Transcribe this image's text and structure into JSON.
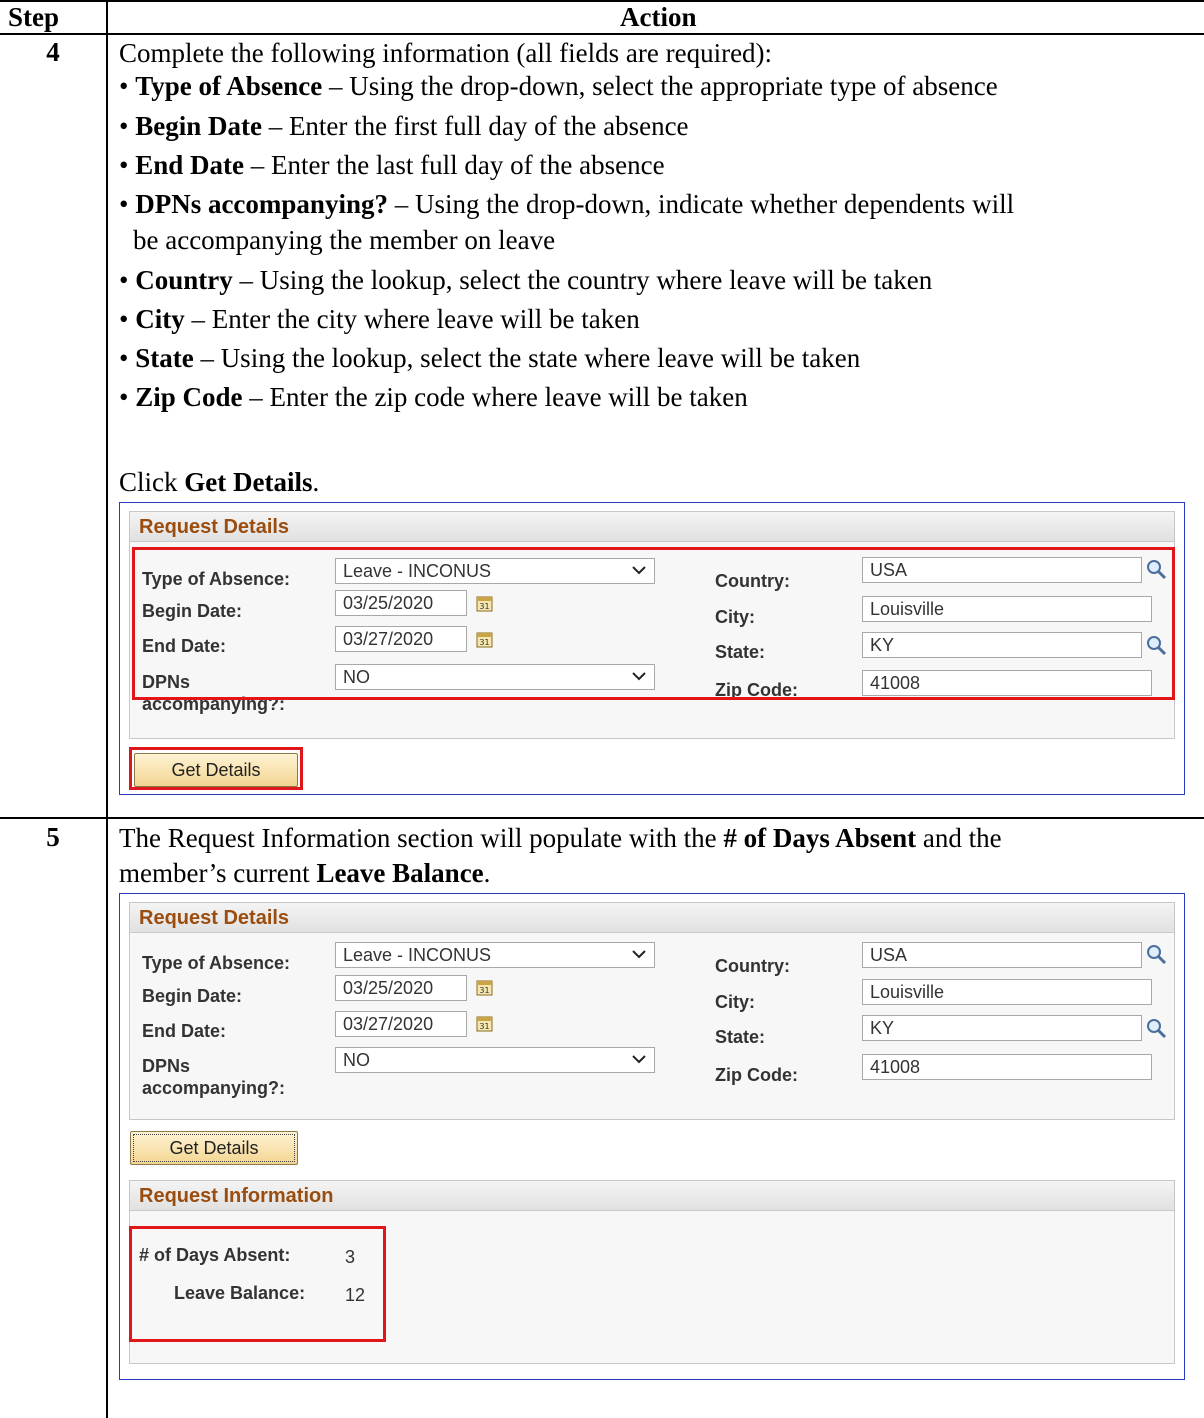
{
  "table": {
    "header_step": "Step",
    "header_action": "Action"
  },
  "step4": {
    "number": "4",
    "intro": "Complete the following information (all fields are required):",
    "bullets": [
      {
        "term": "Type of Absence",
        "desc": " – Using the drop-down, select the appropriate type of absence"
      },
      {
        "term": "Begin Date",
        "desc": " – Enter the first full day of the absence"
      },
      {
        "term": "End Date",
        "desc": " – Enter the last full day of the absence"
      },
      {
        "term": "DPNs accompanying?",
        "desc": " – Using the drop-down, indicate whether dependents will"
      },
      {
        "term": "Country",
        "desc": " – Using the lookup, select the country where leave will be taken"
      },
      {
        "term": "City",
        "desc": " – Enter the city where leave will be taken"
      },
      {
        "term": "State",
        "desc": " – Using the lookup, select the state where leave will be taken"
      },
      {
        "term": "Zip Code",
        "desc": " – Enter the zip code where leave will be taken"
      }
    ],
    "dpn_continuation": "be accompanying the member on leave",
    "click_prefix": "Click ",
    "click_term": "Get Details",
    "click_suffix": "."
  },
  "step5": {
    "number": "5",
    "line1_a": "The Request Information section will populate with the ",
    "line1_b": "# of Days Absent",
    "line1_c": " and the",
    "line2_a": "member’s current ",
    "line2_b": "Leave Balance",
    "line2_c": "."
  },
  "form": {
    "section_title": "Request Details",
    "type_label": "Type of Absence:",
    "type_value": "Leave - INCONUS",
    "begin_label": "Begin Date:",
    "begin_value": "03/25/2020",
    "end_label": "End Date:",
    "end_value": "03/27/2020",
    "dpn_label_1": "DPNs",
    "dpn_label_2": "accompanying?:",
    "dpn_value": "NO",
    "country_label": "Country:",
    "country_value": "USA",
    "city_label": "City:",
    "city_value": "Louisville",
    "state_label": "State:",
    "state_value": "KY",
    "zip_label": "Zip Code:",
    "zip_value": "41008",
    "button": "Get Details",
    "calendar_icon_text": "31"
  },
  "info": {
    "section_title": "Request Information",
    "days_label": "# of Days Absent:",
    "days_value": "3",
    "balance_label": "Leave Balance:",
    "balance_value": "12"
  },
  "colors": {
    "highlight": "#e0161b",
    "section_title": "#9a4d0e",
    "screenshot_border": "#2a3bbd"
  }
}
